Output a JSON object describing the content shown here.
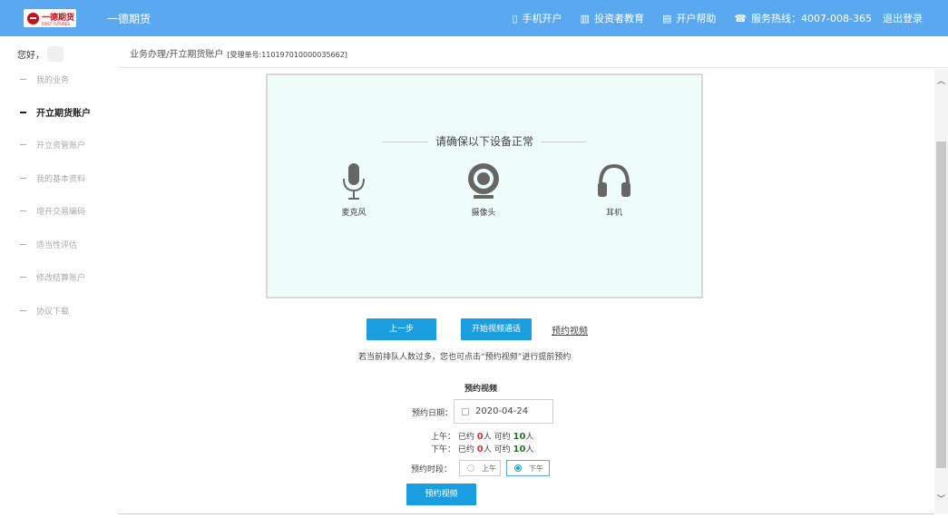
{
  "header": {
    "logo_text": "一德期货",
    "logo_sub": "FIRST FUTURES",
    "brand": "一德期货",
    "nav": [
      {
        "icon": "phone-icon",
        "glyph": "▯",
        "label": "手机开户"
      },
      {
        "icon": "book-icon",
        "glyph": "▥",
        "label": "投资者教育"
      },
      {
        "icon": "guide-icon",
        "glyph": "▤",
        "label": "开户帮助"
      },
      {
        "icon": "hotline-icon",
        "glyph": "☎",
        "label": "服务热线：4007-008-365"
      }
    ],
    "logout": "退出登录"
  },
  "sidebar": {
    "greeting": "您好，",
    "items": [
      {
        "label": "我的业务",
        "active": false
      },
      {
        "label": "开立期货账户",
        "active": true
      },
      {
        "label": "开立资管账户",
        "active": false
      },
      {
        "label": "我的基本资料",
        "active": false
      },
      {
        "label": "增开交易编码",
        "active": false
      },
      {
        "label": "适当性评估",
        "active": false
      },
      {
        "label": "修改结算账户",
        "active": false
      },
      {
        "label": "协议下载",
        "active": false
      }
    ]
  },
  "main": {
    "breadcrumb": "业务办理/开立期货账户",
    "order_no": "[受理单号:110197010000035662]",
    "panel": {
      "title": "请确保以下设备正常",
      "devices": [
        {
          "icon": "microphone-icon",
          "label": "麦克风"
        },
        {
          "icon": "camera-icon",
          "label": "摄像头"
        },
        {
          "icon": "headphones-icon",
          "label": "耳机"
        }
      ]
    },
    "actions": {
      "prev": "上一步",
      "start_video": "开始视频通话",
      "book_video": "预约视频"
    },
    "hint": "若当前排队人数过多，您也可点击“预约视频”进行提前预约",
    "appointment": {
      "title": "预约视频",
      "date_label": "预约日期：",
      "date_value": "2020-04-24",
      "am": {
        "label": "上午：",
        "booked_prefix": "已约",
        "booked": "0",
        "unit1": "人 可约",
        "available": "10",
        "unit2": "人"
      },
      "pm": {
        "label": "下午：",
        "booked_prefix": "已约",
        "booked": "0",
        "unit1": "人 可约",
        "available": "10",
        "unit2": "人"
      },
      "slot_label": "预约时段：",
      "slot_am": "上午",
      "slot_pm": "下午",
      "selected_slot": "下午",
      "submit": "预约视频"
    }
  },
  "colors": {
    "header_bg": "#5aa9f0",
    "button_bg": "#1a9ee0",
    "panel_bg": "#eefcfc",
    "booked_red": "#e03030",
    "available_green": "#1a7f1a"
  }
}
